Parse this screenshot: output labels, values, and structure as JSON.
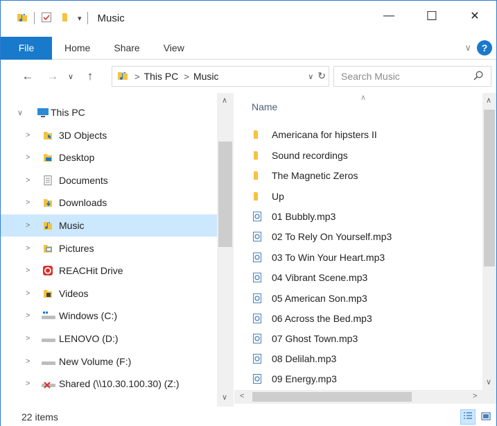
{
  "window": {
    "title": "Music",
    "quick_access_dropdown": "▾",
    "minimize": "—",
    "maximize": "☐",
    "close": "✕"
  },
  "ribbon": {
    "tabs": [
      "File",
      "Home",
      "Share",
      "View"
    ],
    "expand": "∨",
    "help": "?"
  },
  "address": {
    "crumbs": [
      "This PC",
      "Music"
    ],
    "separator": ">",
    "search_placeholder": "Search Music"
  },
  "nav": {
    "items": [
      {
        "label": "This PC",
        "icon": "this-pc-icon",
        "expanded": true
      },
      {
        "label": "3D Objects",
        "icon": "3d-objects-icon"
      },
      {
        "label": "Desktop",
        "icon": "desktop-icon"
      },
      {
        "label": "Documents",
        "icon": "documents-icon"
      },
      {
        "label": "Downloads",
        "icon": "downloads-icon"
      },
      {
        "label": "Music",
        "icon": "music-icon",
        "selected": true
      },
      {
        "label": "Pictures",
        "icon": "pictures-icon"
      },
      {
        "label": "REACHit Drive",
        "icon": "reachit-drive-icon"
      },
      {
        "label": "Videos",
        "icon": "videos-icon"
      },
      {
        "label": "Windows (C:)",
        "icon": "windows-drive-icon"
      },
      {
        "label": "LENOVO (D:)",
        "icon": "drive-icon"
      },
      {
        "label": "New Volume (F:)",
        "icon": "drive-icon"
      },
      {
        "label": "Shared (\\\\10.30.100.30) (Z:)",
        "icon": "network-drive-disconnected-icon"
      }
    ]
  },
  "content": {
    "column_header": "Name",
    "files": [
      {
        "name": "Americana for hipsters II",
        "type": "folder"
      },
      {
        "name": "Sound recordings",
        "type": "folder"
      },
      {
        "name": "The Magnetic Zeros",
        "type": "folder"
      },
      {
        "name": "Up",
        "type": "folder"
      },
      {
        "name": "01 Bubbly.mp3",
        "type": "mp3"
      },
      {
        "name": "02 To Rely On Yourself.mp3",
        "type": "mp3"
      },
      {
        "name": "03 To Win Your Heart.mp3",
        "type": "mp3"
      },
      {
        "name": "04 Vibrant Scene.mp3",
        "type": "mp3"
      },
      {
        "name": "05 American Son.mp3",
        "type": "mp3"
      },
      {
        "name": "06 Across the Bed.mp3",
        "type": "mp3"
      },
      {
        "name": "07 Ghost Town.mp3",
        "type": "mp3"
      },
      {
        "name": "08 Delilah.mp3",
        "type": "mp3"
      },
      {
        "name": "09 Energy.mp3",
        "type": "mp3"
      }
    ]
  },
  "status": {
    "item_count": "22 items"
  },
  "colors": {
    "accent": "#1979ca",
    "selection": "#cce8ff",
    "folder": "#f5c242"
  }
}
